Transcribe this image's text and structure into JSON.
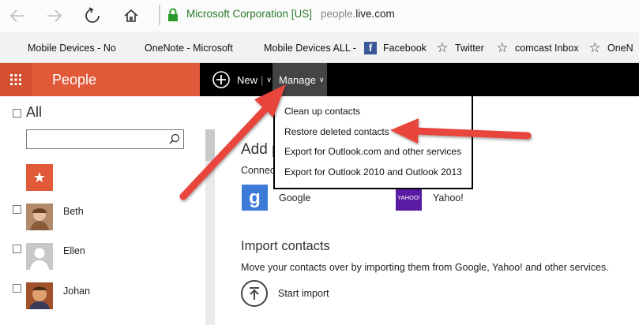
{
  "browser": {
    "site_badge": "Microsoft Corporation [US]",
    "url_prefix": "people.",
    "url_domain": "live.com",
    "colors": {
      "badge_green": "#2a7a2a"
    },
    "nav_icons": [
      "back-arrow-icon",
      "forward-arrow-icon",
      "refresh-icon",
      "home-icon",
      "lock-icon"
    ]
  },
  "favorites": [
    {
      "label": "Mobile Devices - No",
      "icon": "microsoft-logo-icon"
    },
    {
      "label": "OneNote - Microsoft",
      "icon": "microsoft-logo-icon"
    },
    {
      "label": "Mobile Devices ALL -",
      "icon": "microsoft-logo-icon"
    },
    {
      "label": "Facebook",
      "icon": "facebook-icon"
    },
    {
      "label": "Twitter",
      "icon": "star-icon"
    },
    {
      "label": "comcast Inbox",
      "icon": "star-icon"
    },
    {
      "label": "OneN",
      "icon": "star-icon"
    }
  ],
  "app": {
    "title": "People",
    "new_label": "New",
    "manage_label": "Manage",
    "colors": {
      "brand": "#e05a3a",
      "header_bg": "#000000",
      "manage_bg": "#444444"
    }
  },
  "menu": {
    "items": [
      "Clean up contacts",
      "Restore deleted contacts",
      "Export for Outlook.com and other services",
      "Export for Outlook 2010 and Outlook 2013"
    ]
  },
  "sidebar": {
    "all_label": "All",
    "search_placeholder": "",
    "contacts": [
      {
        "name": "Beth"
      },
      {
        "name": "Ellen"
      },
      {
        "name": "Johan"
      }
    ]
  },
  "main": {
    "add_title": "Add p",
    "connect_text": "Connec",
    "services": [
      {
        "label": "Google",
        "icon_text": "g"
      },
      {
        "label": "Yahoo!",
        "icon_text": "YAHOO!"
      }
    ],
    "import_title": "Import contacts",
    "import_desc": "Move your contacts over by importing them from Google, Yahoo! and other services.",
    "import_action": "Start import"
  },
  "annotation": {
    "arrow_color": "#e8453c"
  }
}
